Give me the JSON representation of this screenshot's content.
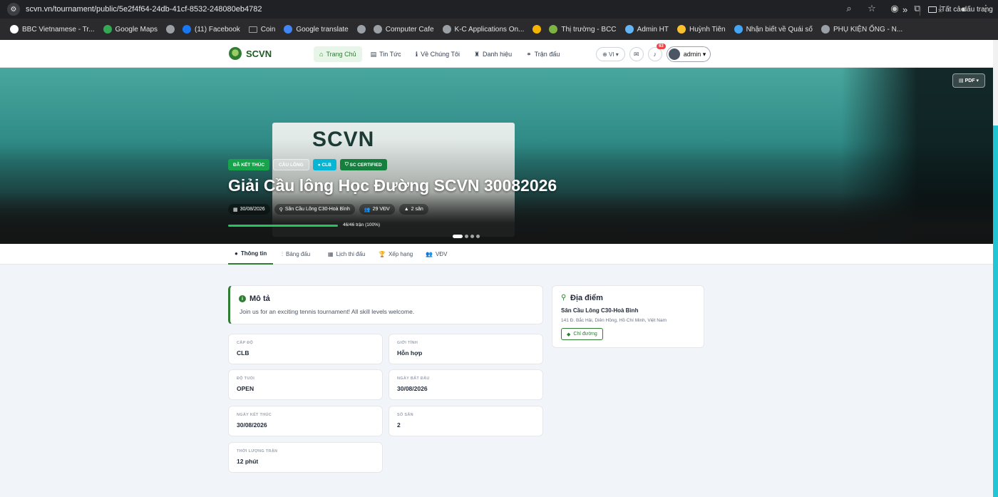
{
  "browser": {
    "url": "scvn.vn/tournament/public/5e2f4f64-24db-41cf-8532-248080eb4782",
    "bookmarks": [
      {
        "label": "BBC Vietnamese - Tr...",
        "icon": "bbc-icon",
        "color": "#ffffff"
      },
      {
        "label": "Google Maps",
        "icon": "maps-icon",
        "color": "#34a853"
      },
      {
        "label": "",
        "icon": "globe-icon",
        "color": "#9aa0a6"
      },
      {
        "label": "(11) Facebook",
        "icon": "facebook-icon",
        "color": "#1877f2"
      },
      {
        "label": "Coin",
        "icon": "folder-icon",
        "color": "#9aa0a6"
      },
      {
        "label": "Google translate",
        "icon": "translate-icon",
        "color": "#4285f4"
      },
      {
        "label": "",
        "icon": "globe-icon",
        "color": "#9aa0a6"
      },
      {
        "label": "Computer Cafe",
        "icon": "globe-icon",
        "color": "#9aa0a6"
      },
      {
        "label": "K-C Applications On...",
        "icon": "globe-icon",
        "color": "#9aa0a6"
      },
      {
        "label": "",
        "icon": "site-icon",
        "color": "#f4b400"
      },
      {
        "label": "Thị trường - BCC",
        "icon": "bcc-icon",
        "color": "#7cb342"
      },
      {
        "label": "Admin HT",
        "icon": "admin-icon",
        "color": "#64b5f6"
      },
      {
        "label": "Huỳnh Tiên",
        "icon": "crown-icon",
        "color": "#fbc02d"
      },
      {
        "label": "Nhận biết về Quái số",
        "icon": "diamond-icon",
        "color": "#42a5f5"
      },
      {
        "label": "PHỤ KIỆN ỐNG - N...",
        "icon": "globe-icon",
        "color": "#9aa0a6"
      }
    ],
    "more": "»",
    "all_bookmarks": "Tất cả dấu trang"
  },
  "header": {
    "brand": "SCVN",
    "nav": [
      {
        "label": "Trang Chủ",
        "icon": "⌂",
        "active": true
      },
      {
        "label": "Tin Tức",
        "icon": "▤",
        "active": false
      },
      {
        "label": "Về Chúng Tôi",
        "icon": "ℹ",
        "active": false
      },
      {
        "label": "Danh hiệu",
        "icon": "♜",
        "active": false
      },
      {
        "label": "Trận đấu",
        "icon": "⚭",
        "active": false
      }
    ],
    "language": "VI",
    "notification_count": "63",
    "user": "admin"
  },
  "hero": {
    "pdf_label": "PDF",
    "banner_text": "SCVN",
    "tags": [
      "ĐÃ KẾT THÚC",
      "CẦU LÔNG",
      "CLB",
      "SC CERTIFIED"
    ],
    "title": "Giải Cầu lông Học Đường SCVN 30082026",
    "meta": [
      {
        "icon": "▦",
        "text": "30/08/2026"
      },
      {
        "icon": "⚲",
        "text": "Sân Cầu Lông C30-Hoà Bình"
      },
      {
        "icon": "👥",
        "text": "29 VĐV"
      },
      {
        "icon": "▲",
        "text": "2 sân"
      }
    ],
    "progress_text": "46/46 trận (100%)",
    "progress_fraction": 1.0
  },
  "tabs": [
    {
      "label": "Thông tin",
      "icon": "●",
      "active": true
    },
    {
      "label": "Bảng đấu",
      "icon": "⫶",
      "active": false
    },
    {
      "label": "Lịch thi đấu",
      "icon": "▦",
      "active": false
    },
    {
      "label": "Xếp hạng",
      "icon": "🏆",
      "active": false
    },
    {
      "label": "VĐV",
      "icon": "👥",
      "active": false
    }
  ],
  "description": {
    "title": "Mô tả",
    "text": "Join us for an exciting tennis tournament! All skill levels welcome."
  },
  "info_cards": [
    {
      "label": "CẤP ĐỘ",
      "value": "CLB"
    },
    {
      "label": "GIỚI TÍNH",
      "value": "Hỗn hợp"
    },
    {
      "label": "ĐỘ TUỔI",
      "value": "OPEN"
    },
    {
      "label": "NGÀY BẮT ĐẦU",
      "value": "30/08/2026"
    },
    {
      "label": "NGÀY KẾT THÚC",
      "value": "30/08/2026"
    },
    {
      "label": "SỐ SÂN",
      "value": "2"
    },
    {
      "label": "THỜI LƯỢNG TRẬN",
      "value": "12 phút"
    }
  ],
  "location": {
    "title": "Địa điểm",
    "name": "Sân Cầu Lông C30-Hoà Bình",
    "address": "141 Đ. Bắc Hải, Diên Hồng, Hồ Chí Minh, Việt Nam",
    "directions": "Chỉ đường"
  }
}
